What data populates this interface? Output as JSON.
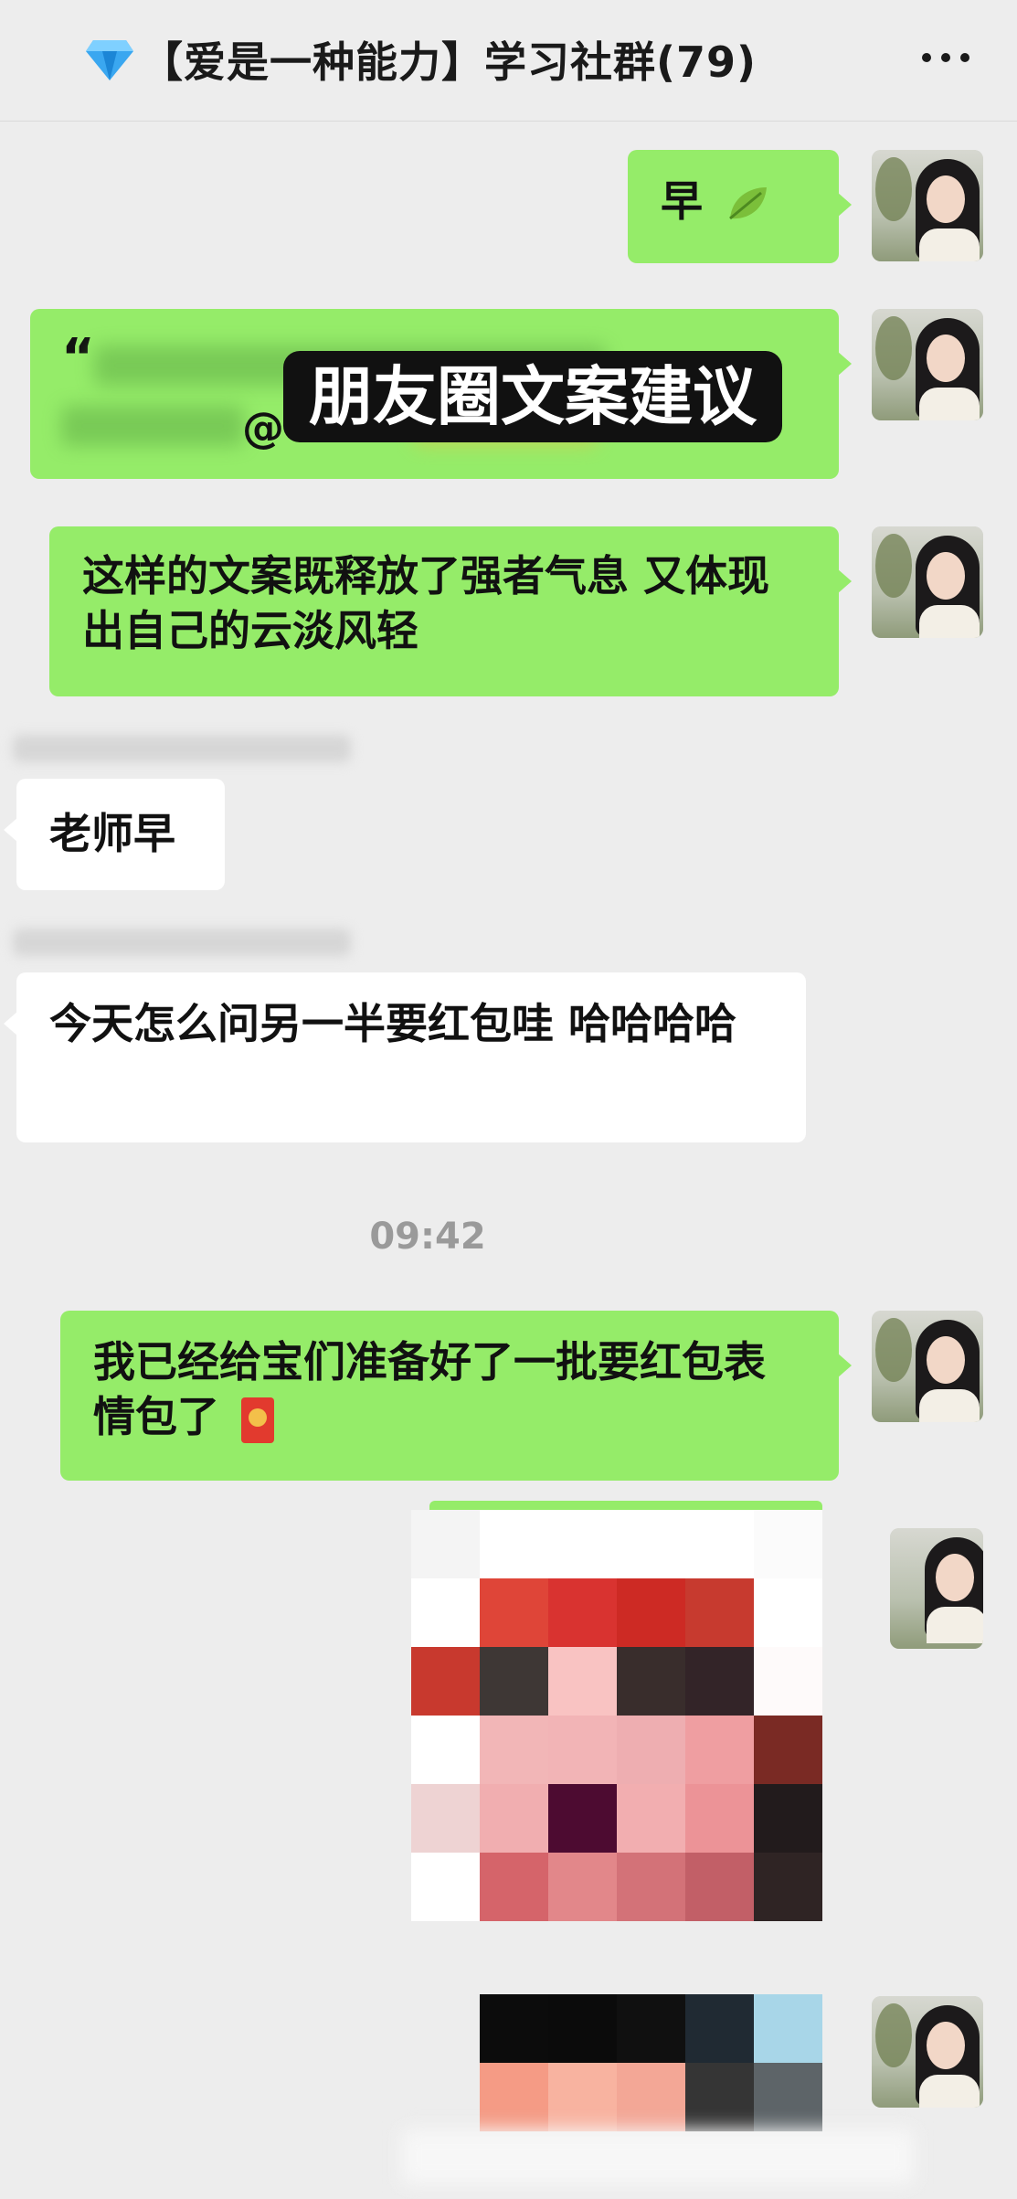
{
  "header": {
    "title_icon": "diamond-icon",
    "title": "【爱是一种能力】学习社群(79)",
    "more_icon": "more-icon"
  },
  "messages": [
    {
      "side": "right",
      "text": "早",
      "emoji": "leaf-icon"
    },
    {
      "side": "right",
      "quote_prefix": "“",
      "quote_at": "@",
      "overlay_label": "朋友圈文案建议"
    },
    {
      "side": "right",
      "text": "这样的文案既释放了强者气息 又体现出自己的云淡风轻"
    },
    {
      "side": "left",
      "text": "老师早"
    },
    {
      "side": "left",
      "text": "今天怎么问另一半要红包哇 哈哈哈哈"
    },
    {
      "side": "right",
      "text": "我已经给宝们准备好了一批要红包表情包了",
      "emoji": "red-packet-icon"
    }
  ],
  "timestamp": "09:42",
  "colors": {
    "background": "#ededed",
    "bubble_me": "#95ec69",
    "bubble_other": "#ffffff"
  }
}
